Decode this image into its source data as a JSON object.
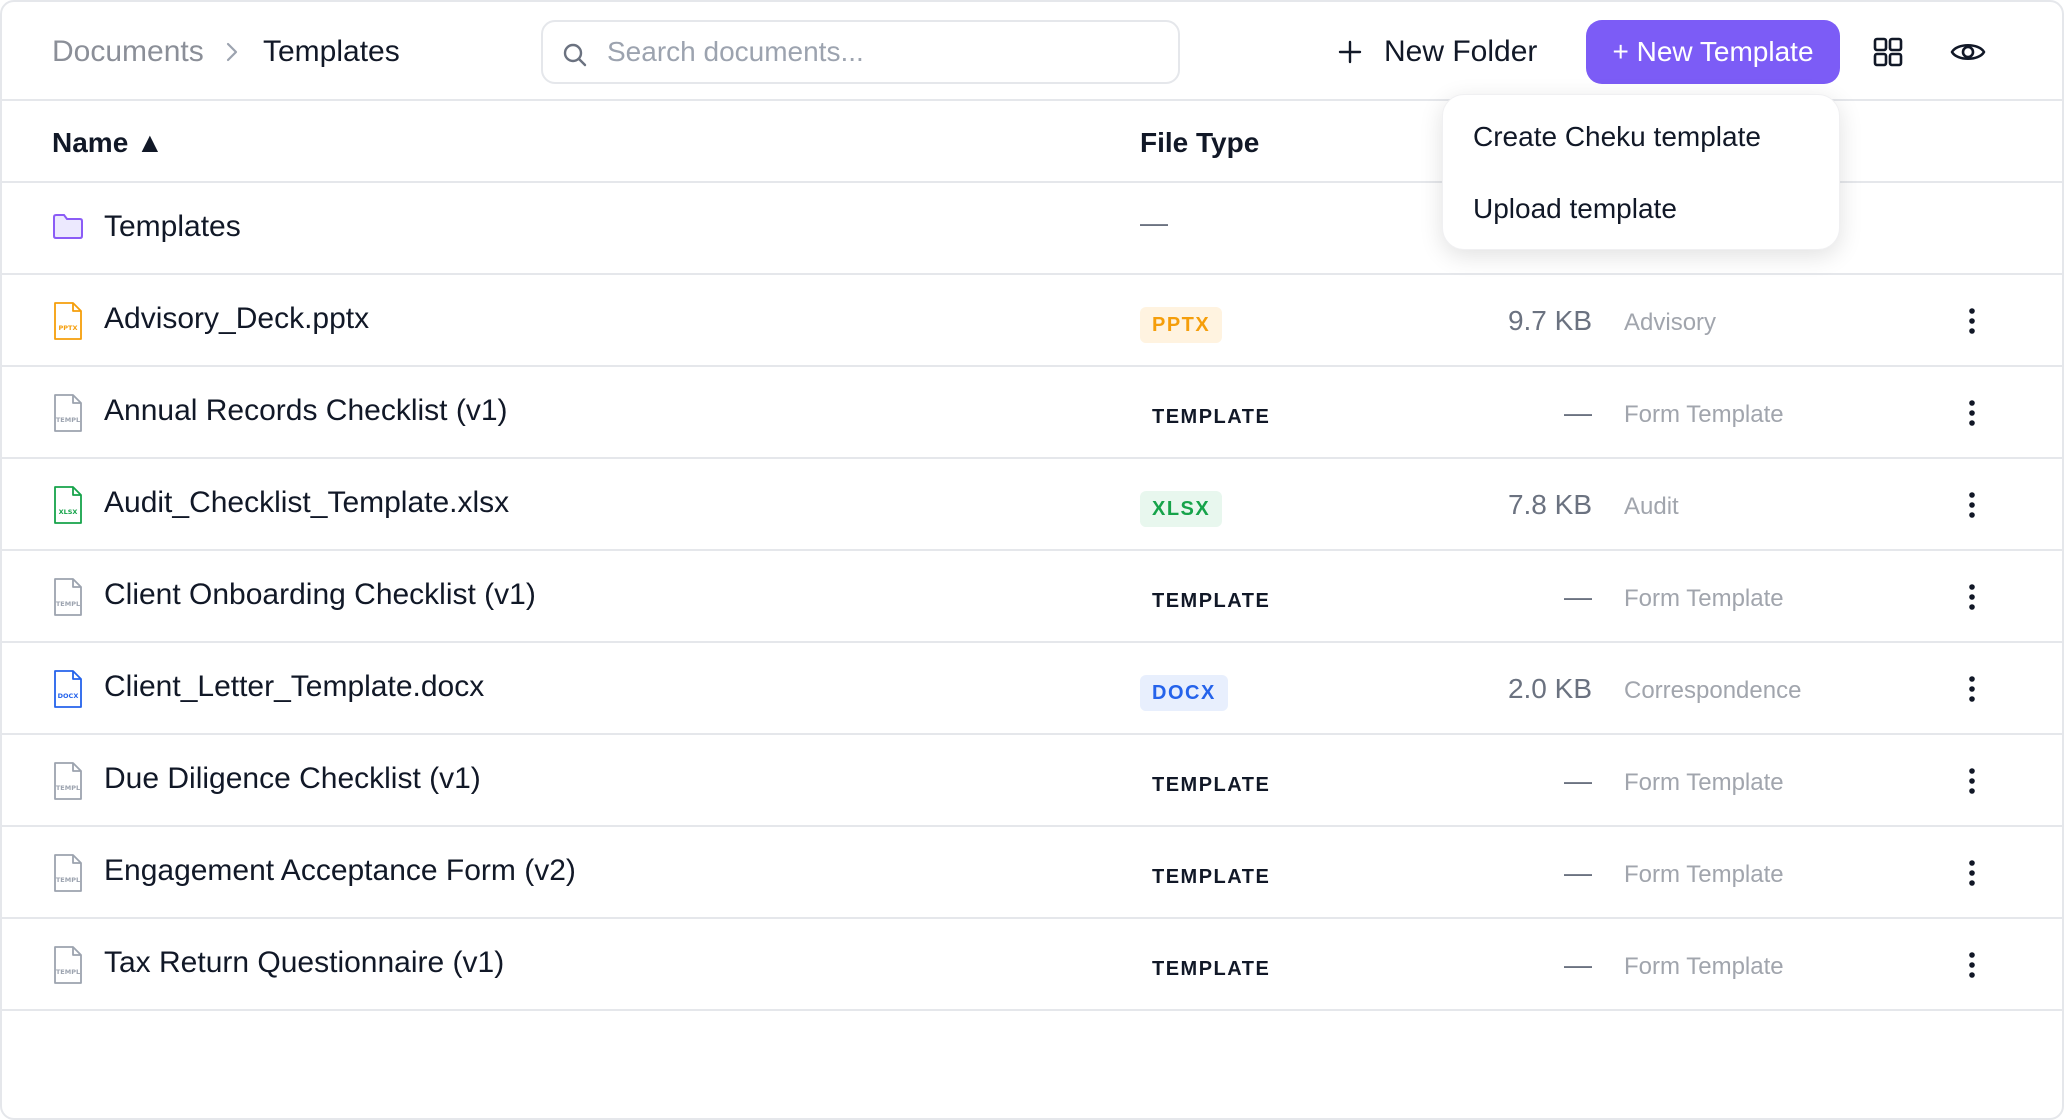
{
  "breadcrumb": {
    "root": "Documents",
    "current": "Templates"
  },
  "search": {
    "placeholder": "Search documents...",
    "value": ""
  },
  "toolbar": {
    "new_folder_label": "New Folder",
    "new_template_label": "+ New Template",
    "accent": "#7c5cf6"
  },
  "dropdown": {
    "items": [
      "Create Cheku template",
      "Upload template"
    ]
  },
  "table": {
    "columns": {
      "name": "Name ▲",
      "file_type": "File Type"
    },
    "folder_row": {
      "name": "Templates",
      "file_type": "—"
    },
    "rows": [
      {
        "name": "Advisory_Deck.pptx",
        "icon": "pptx-file-icon",
        "type": "PPTX",
        "size": "9.7 KB",
        "category": "Advisory"
      },
      {
        "name": "Annual Records Checklist (v1)",
        "icon": "template-file-icon",
        "type": "TEMPLATE",
        "size": "—",
        "category": "Form Template"
      },
      {
        "name": "Audit_Checklist_Template.xlsx",
        "icon": "xlsx-file-icon",
        "type": "XLSX",
        "size": "7.8 KB",
        "category": "Audit"
      },
      {
        "name": "Client Onboarding Checklist (v1)",
        "icon": "template-file-icon",
        "type": "TEMPLATE",
        "size": "—",
        "category": "Form Template"
      },
      {
        "name": "Client_Letter_Template.docx",
        "icon": "docx-file-icon",
        "type": "DOCX",
        "size": "2.0 KB",
        "category": "Correspondence"
      },
      {
        "name": "Due Diligence Checklist (v1)",
        "icon": "template-file-icon",
        "type": "TEMPLATE",
        "size": "—",
        "category": "Form Template"
      },
      {
        "name": "Engagement Acceptance Form (v2)",
        "icon": "template-file-icon",
        "type": "TEMPLATE",
        "size": "—",
        "category": "Form Template"
      },
      {
        "name": "Tax Return Questionnaire (v1)",
        "icon": "template-file-icon",
        "type": "TEMPLATE",
        "size": "—",
        "category": "Form Template"
      }
    ]
  },
  "colors": {
    "pptx": "#f59e0b",
    "xlsx": "#16a34a",
    "docx": "#2563eb",
    "folder": "#8b5cf6"
  }
}
